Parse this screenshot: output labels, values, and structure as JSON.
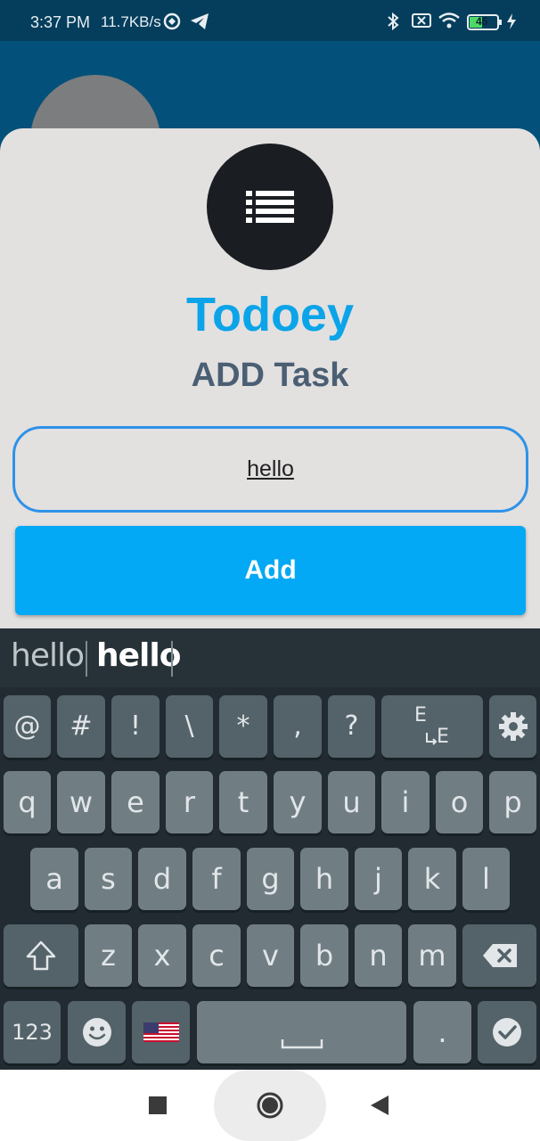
{
  "status_bar": {
    "time": "3:37 PM",
    "net_speed": "11.7KB/s",
    "battery": "45"
  },
  "sheet": {
    "title": "Todoey",
    "subtitle": "ADD Task",
    "input_value": "hello",
    "add_label": "Add"
  },
  "keyboard": {
    "suggestions": [
      "hello",
      "hello"
    ],
    "row0": [
      "@",
      "#",
      "!",
      "\\",
      "*",
      ",",
      "?"
    ],
    "row0_lang": "E",
    "row0_lang_sub": "E",
    "row1": [
      "q",
      "w",
      "e",
      "r",
      "t",
      "y",
      "u",
      "i",
      "o",
      "p"
    ],
    "row2": [
      "a",
      "s",
      "d",
      "f",
      "g",
      "h",
      "j",
      "k",
      "l"
    ],
    "row3": [
      "z",
      "x",
      "c",
      "v",
      "b",
      "n",
      "m"
    ],
    "numbers_label": "123",
    "period_label": "."
  },
  "colors": {
    "accent": "#03a9f4",
    "title": "#0ba4e8",
    "subtitle": "#4a5f73",
    "input_border": "#2e92e8"
  }
}
